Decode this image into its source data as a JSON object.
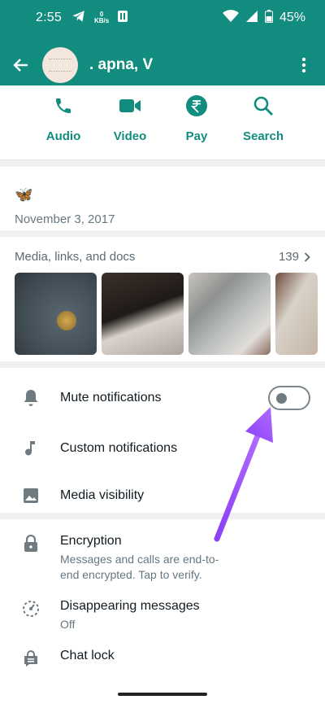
{
  "status_bar": {
    "time": "2:55",
    "kbs_value": "0",
    "kbs_unit": "KB/s",
    "battery": "45%"
  },
  "header": {
    "contact_name": ". apna, V"
  },
  "actions": [
    {
      "label": "Audio",
      "icon": "phone-icon"
    },
    {
      "label": "Video",
      "icon": "video-icon"
    },
    {
      "label": "Pay",
      "icon": "rupee-icon"
    },
    {
      "label": "Search",
      "icon": "search-icon"
    }
  ],
  "about": {
    "emoji": "🦋",
    "date": "November 3, 2017"
  },
  "media": {
    "title": "Media, links, and docs",
    "count": "139"
  },
  "settings": {
    "mute": {
      "label": "Mute notifications",
      "enabled": false
    },
    "custom": {
      "label": "Custom notifications"
    },
    "visibility": {
      "label": "Media visibility"
    },
    "encryption": {
      "title": "Encryption",
      "subtitle": "Messages and calls are end-to-end encrypted. Tap to verify."
    },
    "disappearing": {
      "title": "Disappearing messages",
      "subtitle": "Off"
    },
    "chatlock": {
      "title": "Chat lock"
    }
  },
  "colors": {
    "brand": "#128c7e",
    "arrow": "#9b4dff"
  }
}
